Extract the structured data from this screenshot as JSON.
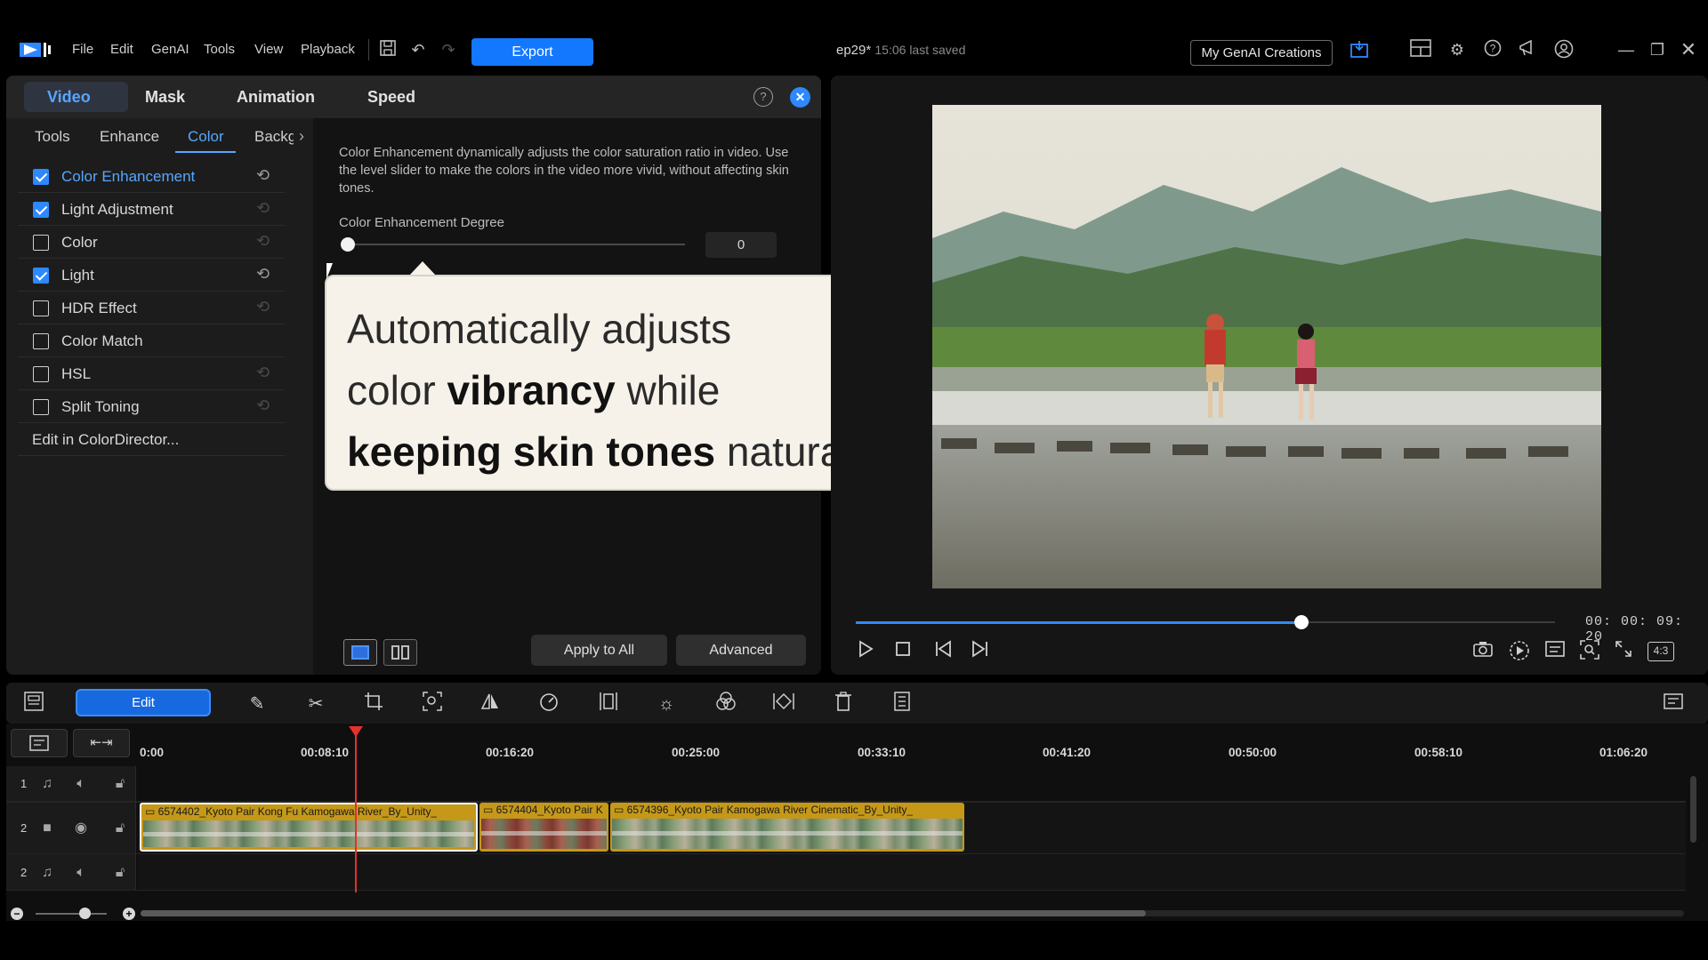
{
  "app": {
    "menu": [
      "File",
      "Edit",
      "GenAI",
      "Tools",
      "View",
      "Playback"
    ],
    "export_label": "Export",
    "project_name": "ep29*",
    "last_saved": "15:06 last saved",
    "genai_creations_label": "My GenAI Creations",
    "accent_color": "#1478ff"
  },
  "panel": {
    "main_tabs": [
      "Video",
      "Mask",
      "Animation",
      "Speed"
    ],
    "sub_tabs": [
      "Tools",
      "Enhance",
      "Color",
      "Backg"
    ],
    "features": [
      {
        "label": "Color Enhancement",
        "checked": true
      },
      {
        "label": "Light Adjustment",
        "checked": true
      },
      {
        "label": "Color",
        "checked": false
      },
      {
        "label": "Light",
        "checked": true
      },
      {
        "label": "HDR Effect",
        "checked": false
      },
      {
        "label": "Color Match",
        "checked": false
      },
      {
        "label": "HSL",
        "checked": false
      },
      {
        "label": "Split Toning",
        "checked": false
      }
    ],
    "colordirector_link": "Edit in ColorDirector...",
    "description": "Color Enhancement dynamically adjusts the color saturation ratio in video. Use the level slider to make the colors in the video more vivid, without affecting skin tones.",
    "degree_label": "Color Enhancement Degree",
    "degree_value": "0",
    "apply_all_label": "Apply to All",
    "advanced_label": "Advanced"
  },
  "callout": {
    "line1": "Automatically adjusts",
    "line2_pre": "color ",
    "line2_bold": "vibrancy",
    "line2_post": " while",
    "line3_bold": "keeping skin tones",
    "line3_post": " natural"
  },
  "preview": {
    "timecode": "00: 00: 09: 20",
    "aspect_label": "4:3",
    "progress_fraction": 0.64
  },
  "timeline": {
    "edit_label": "Edit",
    "ruler": [
      "0:00",
      "00:08:10",
      "00:16:20",
      "00:25:00",
      "00:33:10",
      "00:41:20",
      "00:50:00",
      "00:58:10",
      "01:06:20"
    ],
    "tracks": [
      {
        "num": "1",
        "kind": "audio"
      },
      {
        "num": "2",
        "kind": "video"
      },
      {
        "num": "2",
        "kind": "audio"
      }
    ],
    "clips": [
      {
        "title": "6574402_Kyoto Pair Kong Fu Kamogawa River_By_Unity_"
      },
      {
        "title": "6574404_Kyoto Pair K"
      },
      {
        "title": "6574396_Kyoto Pair Kamogawa River Cinematic_By_Unity_"
      }
    ]
  }
}
